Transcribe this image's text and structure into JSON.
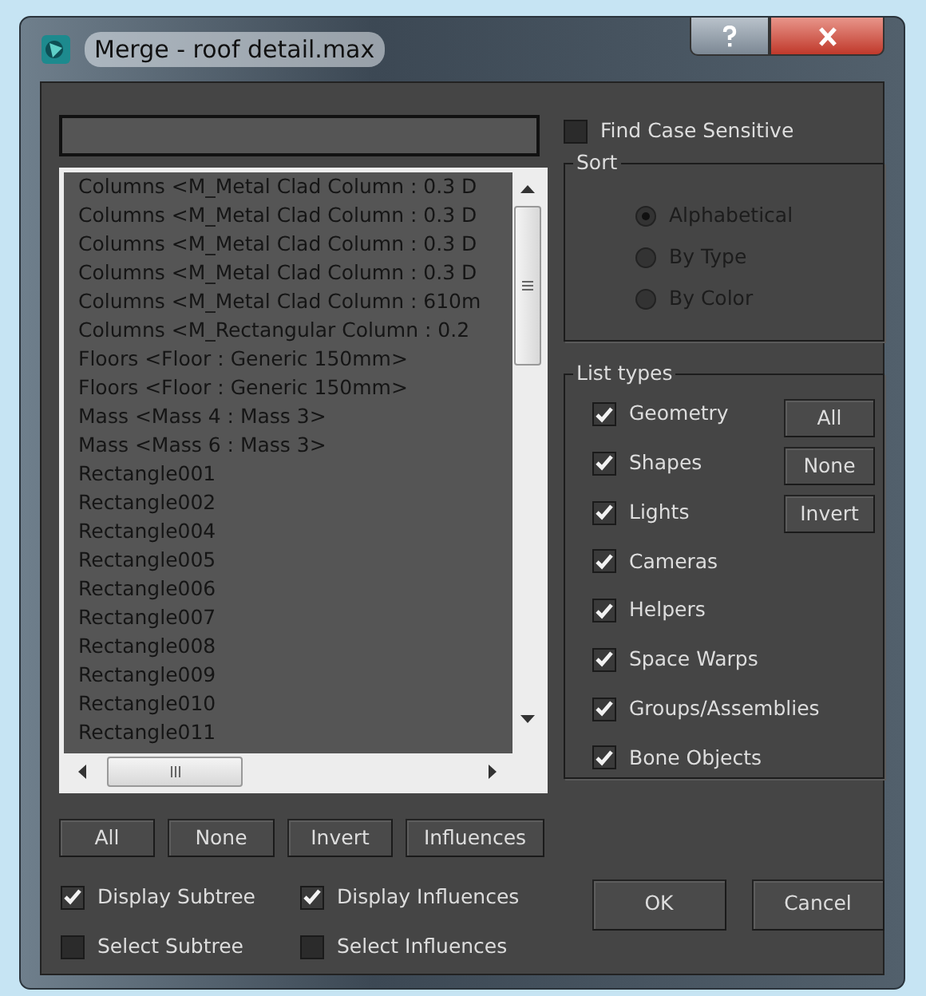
{
  "window": {
    "title": "Merge - roof detail.max"
  },
  "find_case_sensitive": {
    "label": "Find Case Sensitive",
    "checked": false
  },
  "objects": [
    {
      "label": "Columns <M_Metal Clad Column : 0.3 D",
      "selected": false
    },
    {
      "label": "Columns <M_Metal Clad Column : 0.3 D",
      "selected": false
    },
    {
      "label": "Columns <M_Metal Clad Column : 0.3 D",
      "selected": false
    },
    {
      "label": "Columns <M_Metal Clad Column : 0.3 D",
      "selected": false
    },
    {
      "label": "Columns <M_Metal Clad Column : 610m",
      "selected": false
    },
    {
      "label": "Columns <M_Rectangular Column : 0.2",
      "selected": false
    },
    {
      "label": "Floors <Floor : Generic 150mm>",
      "selected": false
    },
    {
      "label": "Floors <Floor : Generic 150mm>",
      "selected": false
    },
    {
      "label": "Mass <Mass 4 : Mass 3>",
      "selected": false
    },
    {
      "label": "Mass <Mass 6 : Mass 3>",
      "selected": false
    },
    {
      "label": "Rectangle001",
      "selected": false
    },
    {
      "label": "Rectangle002",
      "selected": false
    },
    {
      "label": "Rectangle004",
      "selected": false
    },
    {
      "label": "Rectangle005",
      "selected": false
    },
    {
      "label": "Rectangle006",
      "selected": false
    },
    {
      "label": "Rectangle007",
      "selected": false
    },
    {
      "label": "Rectangle008",
      "selected": false
    },
    {
      "label": "Rectangle009",
      "selected": false
    },
    {
      "label": "Rectangle010",
      "selected": false
    },
    {
      "label": "Rectangle011",
      "selected": false
    }
  ],
  "list_buttons": [
    "All",
    "None",
    "Invert",
    "Influences"
  ],
  "options": [
    {
      "label": "Display Subtree",
      "checked": true
    },
    {
      "label": "Display Influences",
      "checked": true
    },
    {
      "label": "Select Subtree",
      "checked": false
    },
    {
      "label": "Select Influences",
      "checked": false
    }
  ],
  "sort": {
    "title": "Sort",
    "options": [
      {
        "label": "Alphabetical",
        "selected": true
      },
      {
        "label": "By Type",
        "selected": false
      },
      {
        "label": "By Color",
        "selected": false
      }
    ]
  },
  "list_types": {
    "title": "List types",
    "items": [
      {
        "label": "Geometry",
        "checked": true
      },
      {
        "label": "Shapes",
        "checked": true
      },
      {
        "label": "Lights",
        "checked": true
      },
      {
        "label": "Cameras",
        "checked": true
      },
      {
        "label": "Helpers",
        "checked": true
      },
      {
        "label": "Space Warps",
        "checked": true
      },
      {
        "label": "Groups/Assemblies",
        "checked": true
      },
      {
        "label": "Bone Objects",
        "checked": true
      }
    ],
    "buttons": [
      "All",
      "None",
      "Invert"
    ]
  },
  "dialog_buttons": [
    "OK",
    "Cancel"
  ]
}
